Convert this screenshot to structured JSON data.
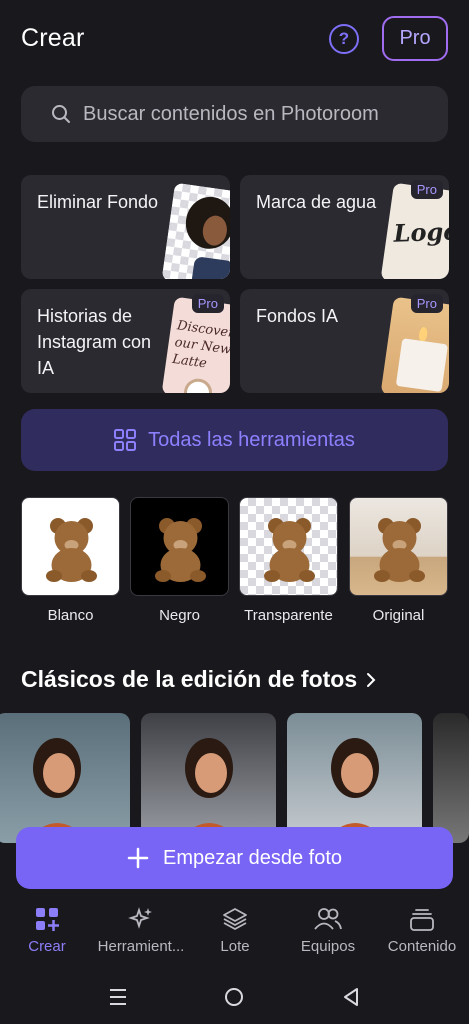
{
  "header": {
    "title": "Crear",
    "help_icon": "question-circle-icon",
    "pro_label": "Pro"
  },
  "search": {
    "placeholder": "Buscar contenidos en Photoroom",
    "icon": "search-icon"
  },
  "tools": [
    {
      "label": "Eliminar Fondo",
      "pro": false
    },
    {
      "label": "Marca de agua",
      "pro": true,
      "badge": "Pro",
      "thumb_text": "Logo"
    },
    {
      "label": "Historias de Instagram con IA",
      "pro": true,
      "badge": "Pro",
      "thumb_text": "Discover our New Latte"
    },
    {
      "label": "Fondos IA",
      "pro": true,
      "badge": "Pro"
    }
  ],
  "all_tools": {
    "label": "Todas las herramientas",
    "icon": "grid-icon"
  },
  "backgrounds": [
    {
      "label": "Blanco",
      "color": "#ffffff"
    },
    {
      "label": "Negro",
      "color": "#000000"
    },
    {
      "label": "Transparente",
      "color": "transparent"
    },
    {
      "label": "Original",
      "color": "#e8dfd4"
    }
  ],
  "classics": {
    "title": "Clásicos de la edición de fotos",
    "chevron_icon": "chevron-right-icon"
  },
  "cta": {
    "label": "Empezar desde foto",
    "icon": "plus-icon"
  },
  "bottom_nav": [
    {
      "label": "Crear",
      "icon": "create-icon",
      "active": true
    },
    {
      "label": "Herramient...",
      "icon": "sparkle-icon",
      "active": false
    },
    {
      "label": "Lote",
      "icon": "layers-icon",
      "active": false
    },
    {
      "label": "Equipos",
      "icon": "people-icon",
      "active": false
    },
    {
      "label": "Contenido",
      "icon": "stack-icon",
      "active": false
    }
  ],
  "colors": {
    "background": "#19181d",
    "card": "#2b2a31",
    "accent": "#7865f5",
    "accent_text": "#8c7ef8"
  }
}
